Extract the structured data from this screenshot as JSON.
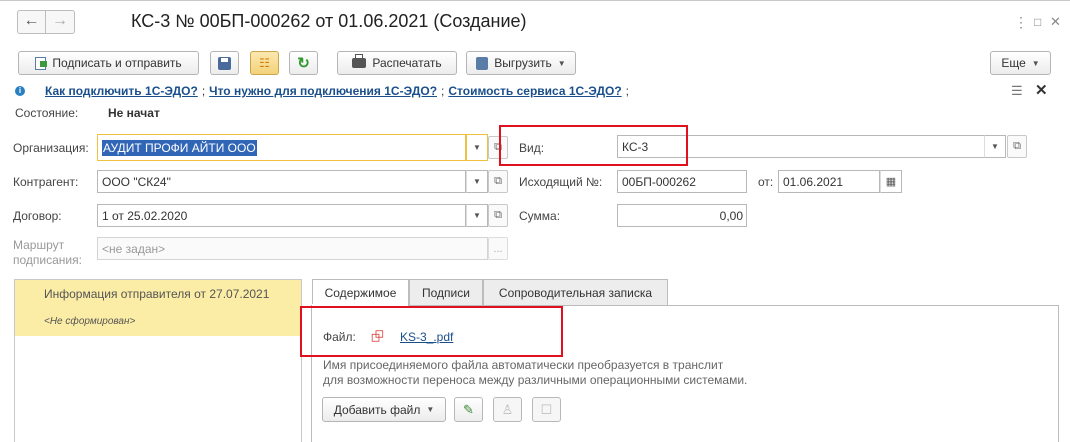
{
  "window": {
    "title": "КС-3 № 00БП-000262 от 01.06.2021 (Создание)",
    "icons": [
      "back-arrow-icon",
      "forward-arrow-icon",
      "more-vertical-icon",
      "maximize-icon",
      "close-icon"
    ]
  },
  "toolbar": {
    "sign_send_label": "Подписать и отправить",
    "print_label": "Распечатать",
    "export_label": "Выгрузить",
    "more_label": "Еще"
  },
  "links": {
    "how_connect": "Как подключить 1С-ЭДО?",
    "what_needed": "Что нужно для подключения 1С-ЭДО?",
    "service_cost": "Стоимость сервиса 1С-ЭДО?",
    "separator": ";"
  },
  "status": {
    "label": "Состояние:",
    "value": "Не начат"
  },
  "form": {
    "organization_label": "Организация:",
    "organization_value": "АУДИТ ПРОФИ АЙТИ ООО",
    "kind_label": "Вид:",
    "kind_value": "КС-3",
    "counterparty_label": "Контрагент:",
    "counterparty_value": "ООО \"СК24\"",
    "outgoing_label": "Исходящий №:",
    "outgoing_value": "00БП-000262",
    "date_label": "от:",
    "date_value": "01.06.2021",
    "contract_label": "Договор:",
    "contract_value": "1 от 25.02.2020",
    "sum_label": "Сумма:",
    "sum_value": "0,00",
    "route_label_1": "Маршрут",
    "route_label_2": "подписания:",
    "route_value": "<не задан>",
    "route_btn": "..."
  },
  "left_panel": {
    "title": "Информация отправителя от 27.07.2021",
    "subtitle": "<Не сформирован>"
  },
  "tabs": [
    {
      "label": "Содержимое",
      "active": true
    },
    {
      "label": "Подписи",
      "active": false
    },
    {
      "label": "Сопроводительная записка",
      "active": false
    }
  ],
  "content": {
    "file_label": "Файл:",
    "file_name": "KS-3_.pdf",
    "hint_line1": "Имя присоединяемого файла автоматически преобразуется в транслит",
    "hint_line2": "для возможности переноса между различными операционными системами.",
    "add_file_label": "Добавить файл"
  },
  "colors": {
    "link": "#1a4f8b",
    "highlight_red": "#e0101f",
    "selection_yellow": "#fbeda5",
    "focus_border": "#f0c040",
    "selected_text_bg": "#3166b6"
  }
}
